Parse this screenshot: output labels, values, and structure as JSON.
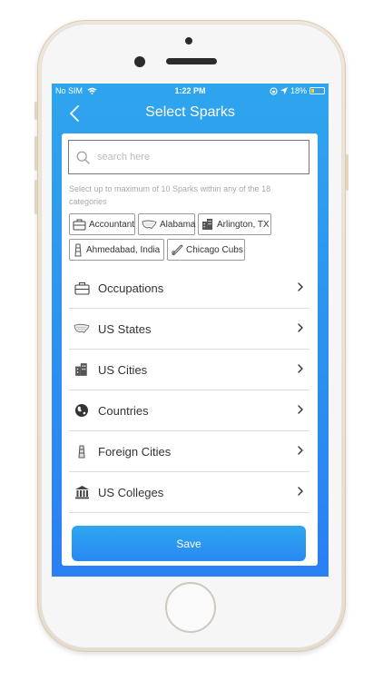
{
  "status_bar": {
    "carrier": "No SIM",
    "time": "1:22 PM",
    "battery": "18%"
  },
  "nav": {
    "title": "Select Sparks"
  },
  "search": {
    "placeholder": "search here"
  },
  "hint": "Select up to maximum of 10 Sparks within any of the 18 categories",
  "chips": [
    {
      "label": "Accountant",
      "icon": "briefcase-icon"
    },
    {
      "label": "Alabama",
      "icon": "us-map-icon"
    },
    {
      "label": "Arlington, TX",
      "icon": "buildings-icon"
    },
    {
      "label": "Ahmedabad, India",
      "icon": "tower-icon"
    },
    {
      "label": "Chicago Cubs",
      "icon": "baseball-bat-icon"
    }
  ],
  "categories": [
    {
      "label": "Occupations",
      "icon": "briefcase-icon"
    },
    {
      "label": "US States",
      "icon": "us-map-icon"
    },
    {
      "label": "US Cities",
      "icon": "buildings-icon"
    },
    {
      "label": "Countries",
      "icon": "globe-icon"
    },
    {
      "label": "Foreign Cities",
      "icon": "tower-icon"
    },
    {
      "label": "US Colleges",
      "icon": "college-icon"
    }
  ],
  "save_label": "Save",
  "colors": {
    "accent": "#2a8ff2",
    "text": "#333333",
    "hint": "#a9a9a9"
  }
}
